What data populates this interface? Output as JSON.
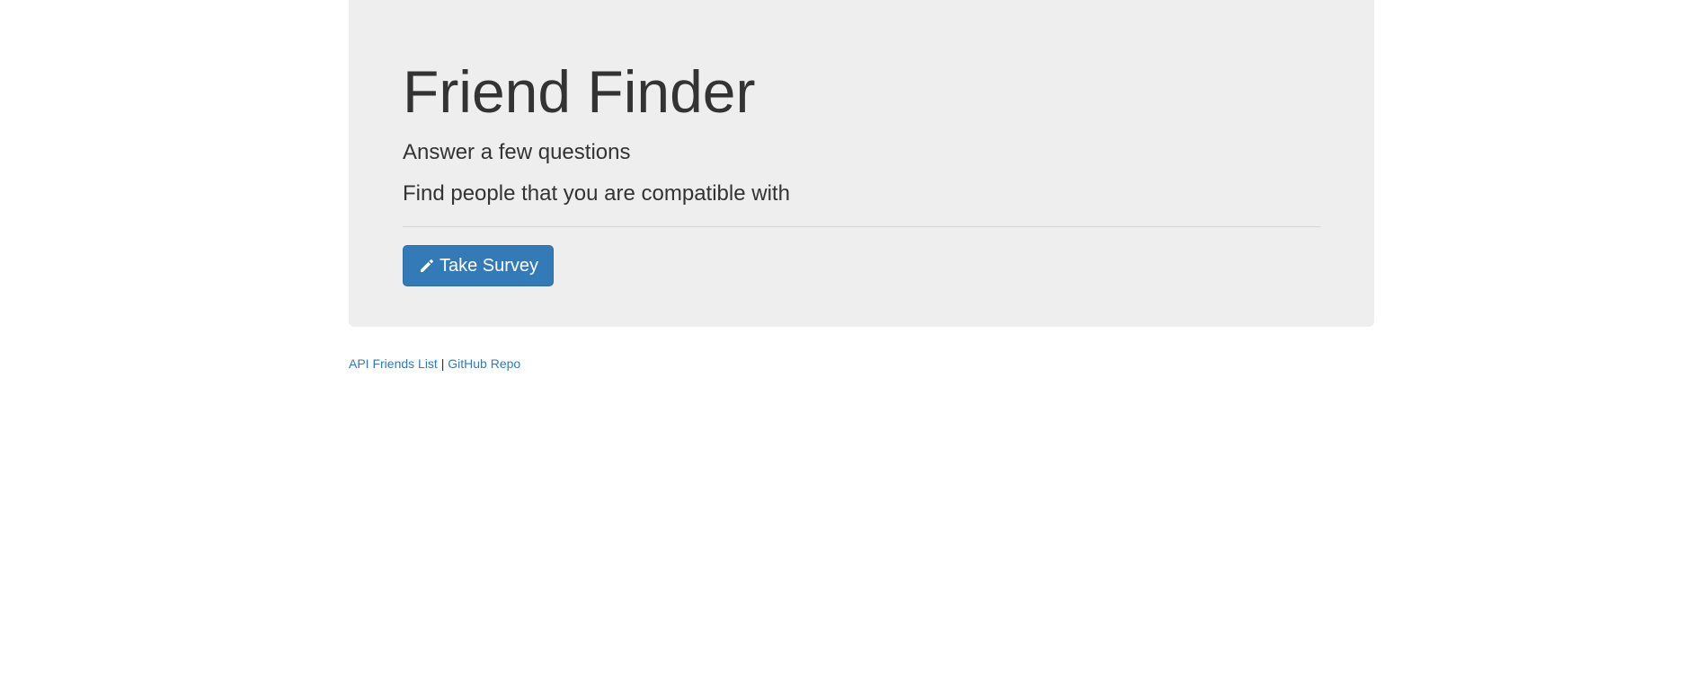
{
  "jumbotron": {
    "title": "Friend Finder",
    "lead_1": "Answer a few questions",
    "lead_2": "Find people that you are compatible with",
    "button": {
      "label": "Take Survey",
      "icon": "pencil-icon",
      "color": "#337ab7"
    }
  },
  "footer": {
    "link_api": "API Friends List",
    "separator": "|",
    "link_github": "GitHub Repo"
  }
}
